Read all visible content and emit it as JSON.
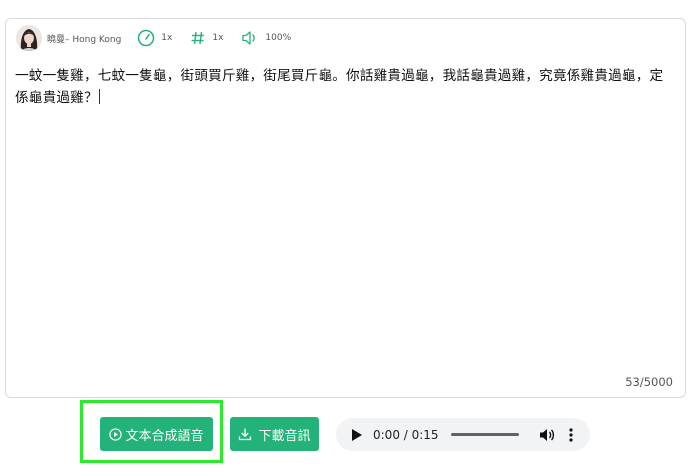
{
  "toolbar": {
    "voice_name": "曉曼– Hong Kong",
    "speed": "1x",
    "pitch": "1x",
    "volume": "100%"
  },
  "editor": {
    "text": "一蚊一隻雞，七蚊一隻龜，街頭買斤雞，街尾買斤龜。你話雞貴過龜，我話龜貴過雞，究竟係雞貴過龜，定係龜貴過雞？",
    "char_count": "53/5000"
  },
  "actions": {
    "synthesize_label": "文本合成語音",
    "download_label": "下載音訊"
  },
  "audio": {
    "time": "0:00 / 0:15",
    "progress": 0
  },
  "colors": {
    "accent": "#23b27a",
    "highlight": "#2ee82e",
    "player_bg": "#f1f3f4"
  }
}
